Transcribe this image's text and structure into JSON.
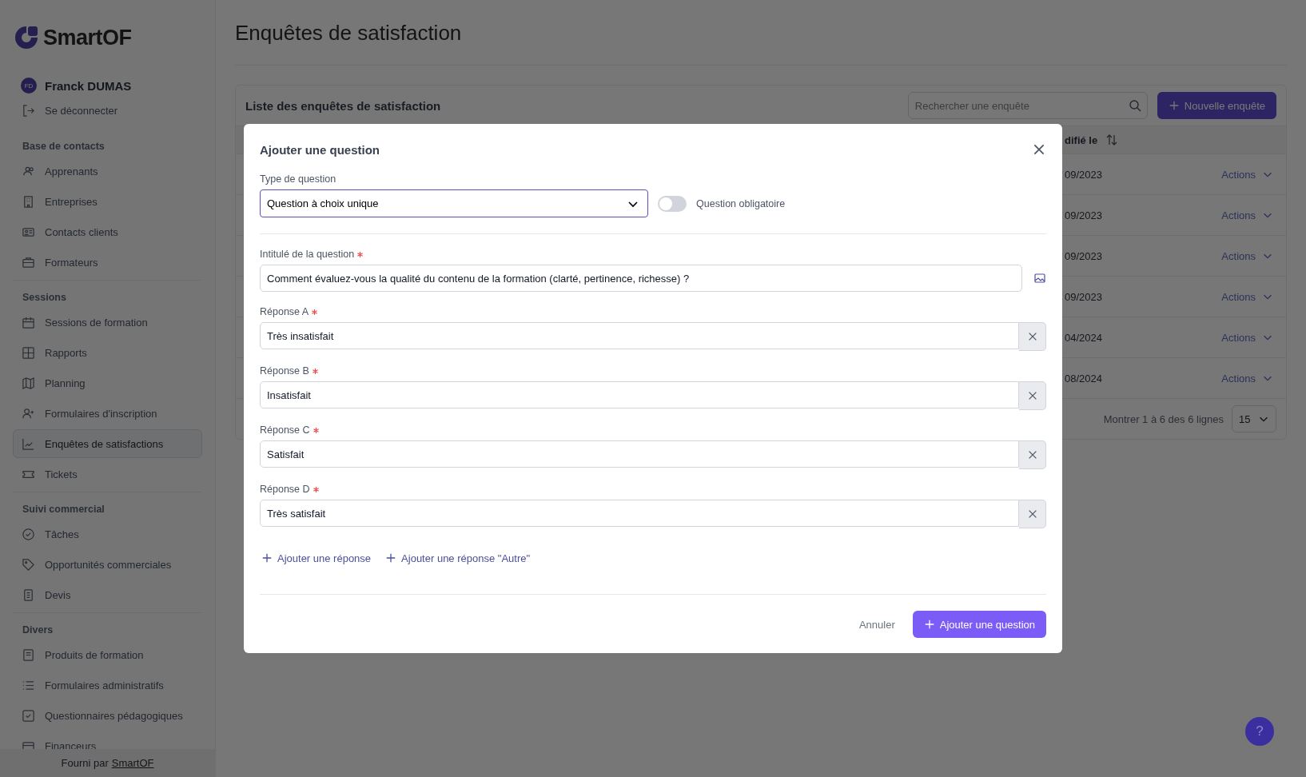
{
  "sidebar": {
    "logo": "SmartOF",
    "user": {
      "initials": "FD",
      "name": "Franck DUMAS"
    },
    "logout": "Se déconnecter",
    "sections": [
      {
        "title": "Base de contacts",
        "items": [
          {
            "label": "Apprenants",
            "selected": false
          },
          {
            "label": "Entreprises",
            "selected": false
          },
          {
            "label": "Contacts clients",
            "selected": false
          },
          {
            "label": "Formateurs",
            "selected": false
          }
        ]
      },
      {
        "title": "Sessions",
        "items": [
          {
            "label": "Sessions de formation",
            "selected": false
          },
          {
            "label": "Rapports",
            "selected": false
          },
          {
            "label": "Planning",
            "selected": false
          },
          {
            "label": "Formulaires d'inscription",
            "selected": false
          },
          {
            "label": "Enquêtes de satisfactions",
            "selected": true
          },
          {
            "label": "Tickets",
            "selected": false
          }
        ]
      },
      {
        "title": "Suivi commercial",
        "items": [
          {
            "label": "Tâches",
            "selected": false
          },
          {
            "label": "Opportunités commerciales",
            "selected": false
          },
          {
            "label": "Devis",
            "selected": false
          }
        ]
      },
      {
        "title": "Divers",
        "items": [
          {
            "label": "Produits de formation",
            "selected": false
          },
          {
            "label": "Formulaires administratifs",
            "selected": false
          },
          {
            "label": "Questionnaires pédagogiques",
            "selected": false
          },
          {
            "label": "Financeurs",
            "selected": false
          }
        ]
      }
    ],
    "footer": {
      "prefix": "Fourni par",
      "link": "SmartOF"
    }
  },
  "page": {
    "title": "Enquêtes de satisfaction"
  },
  "table": {
    "title": "Liste des enquêtes de satisfaction",
    "search": {
      "placeholder": "Rechercher une enquête"
    },
    "new_button": "Nouvelle enquête",
    "column_header": "difié le",
    "rows": [
      {
        "date": "09/2023",
        "action": "Actions"
      },
      {
        "date": "09/2023",
        "action": "Actions"
      },
      {
        "date": "09/2023",
        "action": "Actions"
      },
      {
        "date": "09/2023",
        "action": "Actions"
      },
      {
        "date": "04/2024",
        "action": "Actions"
      },
      {
        "date": "08/2024",
        "action": "Actions"
      }
    ],
    "pagination": {
      "summary": "Montrer 1 à 6 des 6 lignes",
      "page_size": "15"
    }
  },
  "help_button": "?",
  "modal": {
    "title": "Ajouter une question",
    "type_label": "Type de question",
    "type_value": "Question à choix unique",
    "required_toggle": {
      "label": "Question obligatoire",
      "on": false
    },
    "question": {
      "label": "Intitulé de la question",
      "required": true,
      "value": "Comment évaluez-vous la qualité du contenu de la formation (clarté, pertinence, richesse) ?"
    },
    "answers": [
      {
        "label": "Réponse A",
        "required": true,
        "value": "Très insatisfait"
      },
      {
        "label": "Réponse B",
        "required": true,
        "value": "Insatisfait"
      },
      {
        "label": "Réponse C",
        "required": true,
        "value": "Satisfait"
      },
      {
        "label": "Réponse D",
        "required": true,
        "value": "Très satisfait"
      }
    ],
    "links": [
      "Ajouter une réponse",
      "Ajouter une réponse \"Autre\""
    ],
    "cancel": "Annuler",
    "submit": "Ajouter une question"
  }
}
